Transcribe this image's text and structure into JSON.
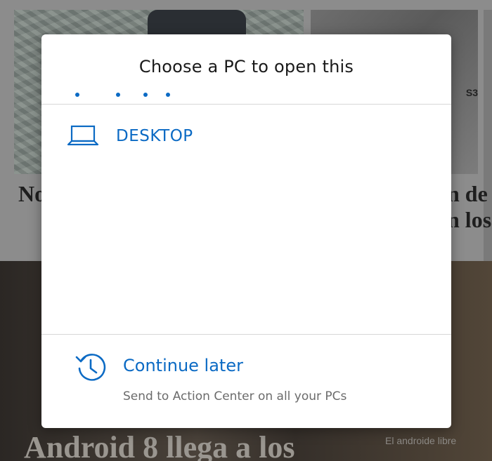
{
  "background": {
    "headline_left": "No",
    "headline_right": [
      "n de",
      "n los"
    ],
    "big_title": "Android 8 llega a los",
    "watermark": "El androide libre",
    "image_badge": "S3"
  },
  "dialog": {
    "title": "Choose a PC to open this",
    "pcs": [
      {
        "name": "DESKTOP",
        "icon": "laptop-icon"
      }
    ],
    "continue_later": {
      "label": "Continue later",
      "description": "Send to Action Center on all your PCs",
      "icon": "history-clock-icon"
    }
  },
  "colors": {
    "accent": "#0b6ac4",
    "dialog_bg": "#ffffff",
    "overlay": "#8c8c8c"
  }
}
